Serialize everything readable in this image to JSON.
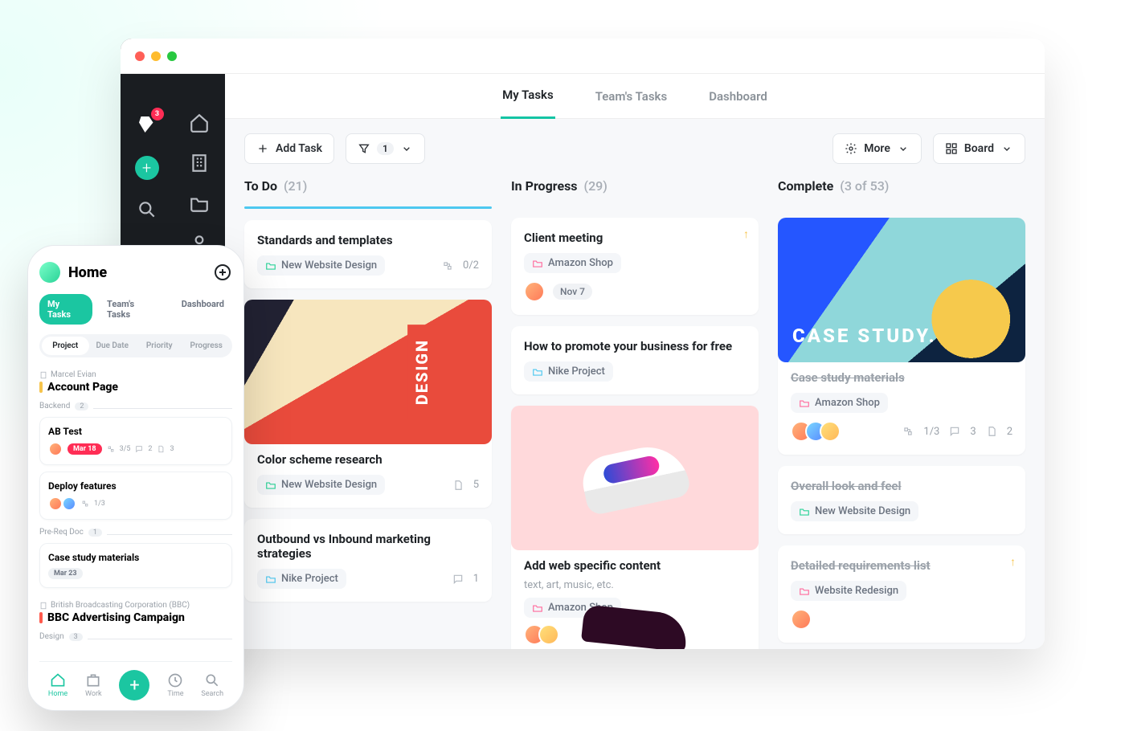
{
  "desktop": {
    "rail": {
      "badge_count": "3"
    },
    "tabs": [
      "My Tasks",
      "Team's Tasks",
      "Dashboard"
    ],
    "active_tab": 0,
    "toolbar": {
      "add_task": "Add Task",
      "filter_count": "1",
      "more": "More",
      "view": "Board"
    },
    "columns": [
      {
        "title": "To Do",
        "count": "(21)",
        "accent": "c-todo",
        "cards": [
          {
            "title": "Standards and templates",
            "tag": "New Website Design",
            "tag_color": "green",
            "subtask": "0/2"
          },
          {
            "image": "design",
            "title": "Color scheme research",
            "tag": "New Website Design",
            "tag_color": "green",
            "files": "5"
          },
          {
            "title": "Outbound vs Inbound marketing strategies",
            "tag": "Nike Project",
            "tag_color": "blue",
            "comments": "1"
          }
        ]
      },
      {
        "title": "In Progress",
        "count": "(29)",
        "accent": "c-prog",
        "cards": [
          {
            "title": "Client meeting",
            "tag": "Amazon Shop",
            "tag_color": "pink",
            "avatars": 1,
            "chip": "Nov 7",
            "pinned": true
          },
          {
            "title": "How to promote your business for free",
            "tag": "Nike Project",
            "tag_color": "blue"
          },
          {
            "image": "shoe",
            "title": "Add web specific content",
            "subtitle": "text, art, music, etc.",
            "tag": "Amazon Shop",
            "tag_color": "pink",
            "avatars": 2
          }
        ]
      },
      {
        "title": "Complete",
        "count": "(3 of 53)",
        "accent": "c-done",
        "cards": [
          {
            "image": "case",
            "image_text": "CASE\nSTUDY.",
            "title": "Case study materials",
            "done": true,
            "tag": "Amazon Shop",
            "tag_color": "pink",
            "avatars": 3,
            "subtask": "1/3",
            "comments": "3",
            "files": "2"
          },
          {
            "title": "Overall look and feel",
            "done": true,
            "tag": "New Website Design",
            "tag_color": "green"
          },
          {
            "title": "Detailed requirements list",
            "done": true,
            "tag": "Website Redesign",
            "tag_color": "pink",
            "avatars": 1,
            "pinned": true
          }
        ]
      }
    ]
  },
  "mobile": {
    "title": "Home",
    "chips": [
      "My Tasks",
      "Team's Tasks",
      "Dashboard"
    ],
    "segments": [
      "Project",
      "Due Date",
      "Priority",
      "Progress"
    ],
    "sections": [
      {
        "crumb": "Marcel Evian",
        "heading": "Account Page",
        "flag": "y",
        "group": "Backend",
        "group_count": "2",
        "cards": [
          {
            "title": "AB Test",
            "pill": "Mar 18",
            "pill_kind": "r",
            "subtask": "3/5",
            "comments": "2",
            "files": "3",
            "avatars": 1
          },
          {
            "title": "Deploy features",
            "subtask": "1/3",
            "avatars": 2
          }
        ],
        "group2": "Pre-Req Doc",
        "group2_count": "1",
        "cards2": [
          {
            "title": "Case study materials",
            "pill": "Mar 23",
            "pill_kind": "g"
          }
        ]
      },
      {
        "crumb": "British Broadcasting Corporation (BBC)",
        "heading": "BBC Advertising Campaign",
        "flag": "r",
        "group": "Design",
        "group_count": "3"
      }
    ],
    "tabbar": [
      "Home",
      "Work",
      "",
      "Time",
      "Search"
    ]
  }
}
